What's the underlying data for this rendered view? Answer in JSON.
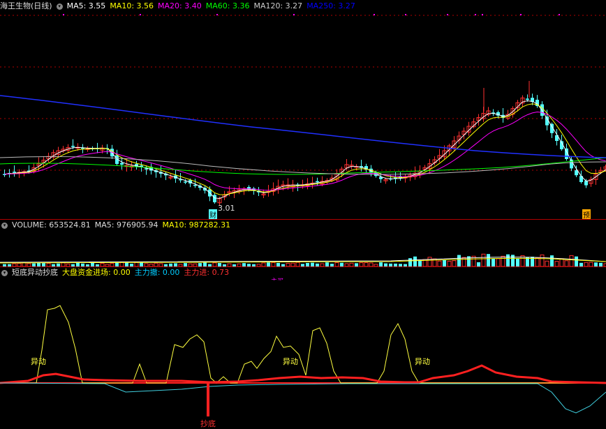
{
  "price_panel": {
    "title": "海王生物(日线)",
    "ma": [
      {
        "label": "MA5: 3.55",
        "color": "#ffffff"
      },
      {
        "label": "MA10: 3.56",
        "color": "#ffff00"
      },
      {
        "label": "MA20: 3.40",
        "color": "#ff00ff"
      },
      {
        "label": "MA60: 3.36",
        "color": "#00ff00"
      },
      {
        "label": "MA120: 3.27",
        "color": "#cccccc"
      },
      {
        "label": "MA250: 3.27",
        "color": "#0000ff"
      }
    ],
    "low_label": "3.01",
    "marker_cai": "财",
    "marker_yu": "预"
  },
  "volume_panel": {
    "labels": [
      {
        "text": "VOLUME: 653524.81",
        "color": "#dddddd"
      },
      {
        "text": "MA5: 976905.94",
        "color": "#dddddd"
      },
      {
        "text": "MA10: 987282.31",
        "color": "#ffff00"
      }
    ]
  },
  "indicator_panel": {
    "labels": [
      {
        "text": "短底异动抄底",
        "color": "#dddddd"
      },
      {
        "text": "大盘资金进场: 0.00",
        "color": "#ffff00"
      },
      {
        "text": "主力撤: 0.00",
        "color": "#00ccff"
      },
      {
        "text": "主力进: 0.73",
        "color": "#ff3030"
      }
    ],
    "stray_text": "主买",
    "signals": [
      "异动",
      "异动",
      "异动"
    ],
    "bottom_label": "抄底"
  },
  "colors": {
    "up": "#ff3030",
    "down": "#54ffff",
    "grid": "#b00000"
  }
}
